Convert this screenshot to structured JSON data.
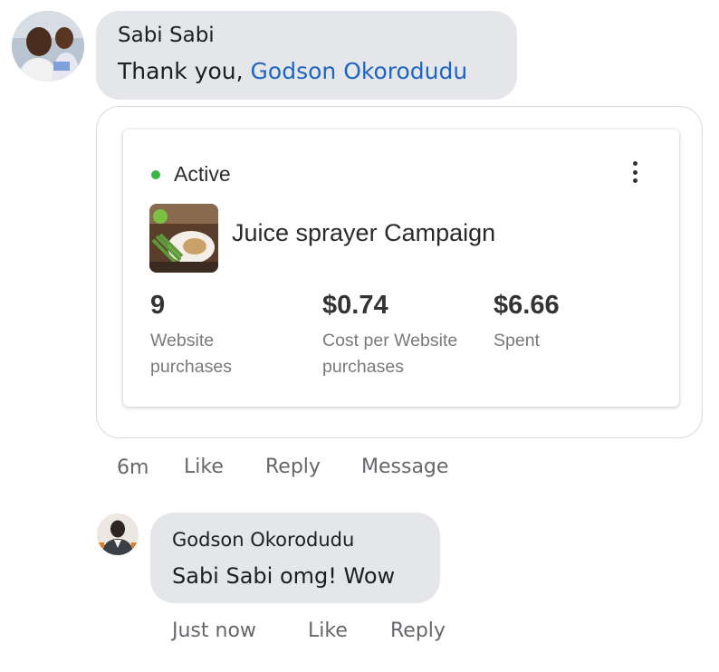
{
  "comment": {
    "author": "Sabi Sabi",
    "text_prefix": "Thank you,",
    "mention": "Godson Okorodudu",
    "time": "6m",
    "actions": {
      "like": "Like",
      "reply": "Reply",
      "message": "Message"
    }
  },
  "campaign_card": {
    "status": "Active",
    "status_color": "#3bb54a",
    "name": "Juice sprayer Campaign",
    "metrics": [
      {
        "value": "9",
        "label_line1": "Website",
        "label_line2": "purchases"
      },
      {
        "value": "$0.74",
        "label_line1": "Cost per Website",
        "label_line2": "purchases"
      },
      {
        "value": "$6.66",
        "label_line1": "Spent",
        "label_line2": ""
      }
    ],
    "menu_icon": "more-vertical-icon"
  },
  "reply": {
    "author": "Godson Okorodudu",
    "text": "Sabi Sabi omg! Wow",
    "time": "Just now",
    "actions": {
      "like": "Like",
      "reply": "Reply"
    }
  },
  "colors": {
    "mention": "#1d66c3",
    "bubble": "#e4e6e9",
    "action_text": "#65676b"
  }
}
